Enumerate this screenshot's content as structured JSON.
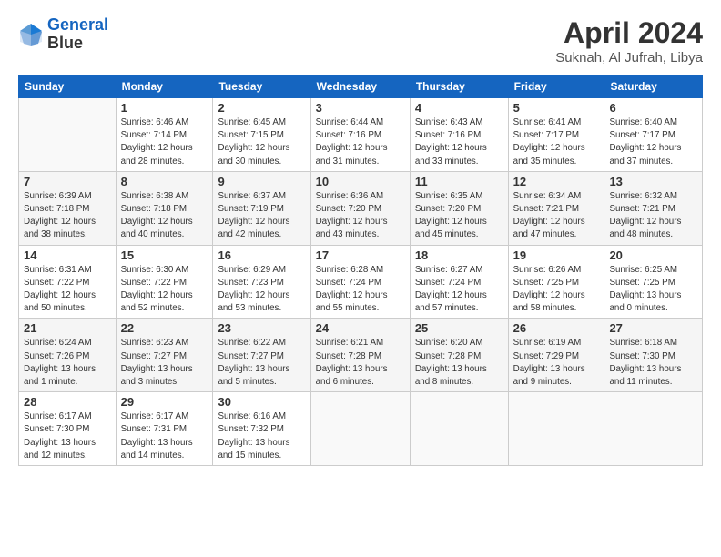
{
  "header": {
    "logo_line1": "General",
    "logo_line2": "Blue",
    "month_year": "April 2024",
    "location": "Suknah, Al Jufrah, Libya"
  },
  "weekdays": [
    "Sunday",
    "Monday",
    "Tuesday",
    "Wednesday",
    "Thursday",
    "Friday",
    "Saturday"
  ],
  "weeks": [
    [
      {
        "day": "",
        "info": ""
      },
      {
        "day": "1",
        "info": "Sunrise: 6:46 AM\nSunset: 7:14 PM\nDaylight: 12 hours\nand 28 minutes."
      },
      {
        "day": "2",
        "info": "Sunrise: 6:45 AM\nSunset: 7:15 PM\nDaylight: 12 hours\nand 30 minutes."
      },
      {
        "day": "3",
        "info": "Sunrise: 6:44 AM\nSunset: 7:16 PM\nDaylight: 12 hours\nand 31 minutes."
      },
      {
        "day": "4",
        "info": "Sunrise: 6:43 AM\nSunset: 7:16 PM\nDaylight: 12 hours\nand 33 minutes."
      },
      {
        "day": "5",
        "info": "Sunrise: 6:41 AM\nSunset: 7:17 PM\nDaylight: 12 hours\nand 35 minutes."
      },
      {
        "day": "6",
        "info": "Sunrise: 6:40 AM\nSunset: 7:17 PM\nDaylight: 12 hours\nand 37 minutes."
      }
    ],
    [
      {
        "day": "7",
        "info": "Sunrise: 6:39 AM\nSunset: 7:18 PM\nDaylight: 12 hours\nand 38 minutes."
      },
      {
        "day": "8",
        "info": "Sunrise: 6:38 AM\nSunset: 7:18 PM\nDaylight: 12 hours\nand 40 minutes."
      },
      {
        "day": "9",
        "info": "Sunrise: 6:37 AM\nSunset: 7:19 PM\nDaylight: 12 hours\nand 42 minutes."
      },
      {
        "day": "10",
        "info": "Sunrise: 6:36 AM\nSunset: 7:20 PM\nDaylight: 12 hours\nand 43 minutes."
      },
      {
        "day": "11",
        "info": "Sunrise: 6:35 AM\nSunset: 7:20 PM\nDaylight: 12 hours\nand 45 minutes."
      },
      {
        "day": "12",
        "info": "Sunrise: 6:34 AM\nSunset: 7:21 PM\nDaylight: 12 hours\nand 47 minutes."
      },
      {
        "day": "13",
        "info": "Sunrise: 6:32 AM\nSunset: 7:21 PM\nDaylight: 12 hours\nand 48 minutes."
      }
    ],
    [
      {
        "day": "14",
        "info": "Sunrise: 6:31 AM\nSunset: 7:22 PM\nDaylight: 12 hours\nand 50 minutes."
      },
      {
        "day": "15",
        "info": "Sunrise: 6:30 AM\nSunset: 7:22 PM\nDaylight: 12 hours\nand 52 minutes."
      },
      {
        "day": "16",
        "info": "Sunrise: 6:29 AM\nSunset: 7:23 PM\nDaylight: 12 hours\nand 53 minutes."
      },
      {
        "day": "17",
        "info": "Sunrise: 6:28 AM\nSunset: 7:24 PM\nDaylight: 12 hours\nand 55 minutes."
      },
      {
        "day": "18",
        "info": "Sunrise: 6:27 AM\nSunset: 7:24 PM\nDaylight: 12 hours\nand 57 minutes."
      },
      {
        "day": "19",
        "info": "Sunrise: 6:26 AM\nSunset: 7:25 PM\nDaylight: 12 hours\nand 58 minutes."
      },
      {
        "day": "20",
        "info": "Sunrise: 6:25 AM\nSunset: 7:25 PM\nDaylight: 13 hours\nand 0 minutes."
      }
    ],
    [
      {
        "day": "21",
        "info": "Sunrise: 6:24 AM\nSunset: 7:26 PM\nDaylight: 13 hours\nand 1 minute."
      },
      {
        "day": "22",
        "info": "Sunrise: 6:23 AM\nSunset: 7:27 PM\nDaylight: 13 hours\nand 3 minutes."
      },
      {
        "day": "23",
        "info": "Sunrise: 6:22 AM\nSunset: 7:27 PM\nDaylight: 13 hours\nand 5 minutes."
      },
      {
        "day": "24",
        "info": "Sunrise: 6:21 AM\nSunset: 7:28 PM\nDaylight: 13 hours\nand 6 minutes."
      },
      {
        "day": "25",
        "info": "Sunrise: 6:20 AM\nSunset: 7:28 PM\nDaylight: 13 hours\nand 8 minutes."
      },
      {
        "day": "26",
        "info": "Sunrise: 6:19 AM\nSunset: 7:29 PM\nDaylight: 13 hours\nand 9 minutes."
      },
      {
        "day": "27",
        "info": "Sunrise: 6:18 AM\nSunset: 7:30 PM\nDaylight: 13 hours\nand 11 minutes."
      }
    ],
    [
      {
        "day": "28",
        "info": "Sunrise: 6:17 AM\nSunset: 7:30 PM\nDaylight: 13 hours\nand 12 minutes."
      },
      {
        "day": "29",
        "info": "Sunrise: 6:17 AM\nSunset: 7:31 PM\nDaylight: 13 hours\nand 14 minutes."
      },
      {
        "day": "30",
        "info": "Sunrise: 6:16 AM\nSunset: 7:32 PM\nDaylight: 13 hours\nand 15 minutes."
      },
      {
        "day": "",
        "info": ""
      },
      {
        "day": "",
        "info": ""
      },
      {
        "day": "",
        "info": ""
      },
      {
        "day": "",
        "info": ""
      }
    ]
  ]
}
